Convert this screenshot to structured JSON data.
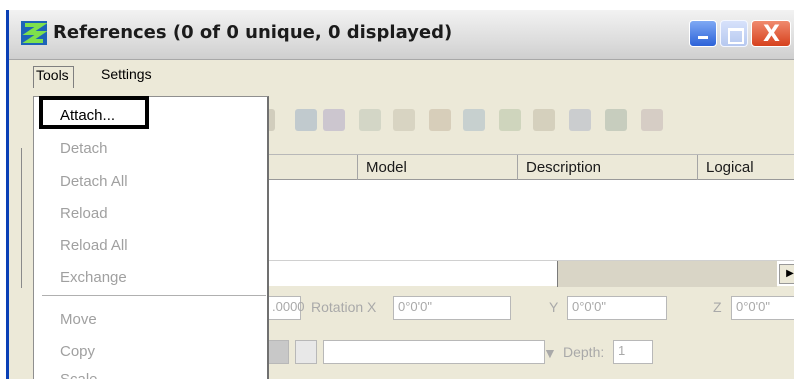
{
  "window": {
    "title": "References (0 of 0 unique, 0 displayed)",
    "controls": [
      "minimize-icon",
      "maximize-icon",
      "close-icon"
    ],
    "close_glyph": "X"
  },
  "menubar": {
    "tools": "Tools",
    "settings": "Settings"
  },
  "tools_menu": {
    "items": [
      {
        "label": "Attach...",
        "enabled": true
      },
      {
        "label": "Detach",
        "enabled": false
      },
      {
        "label": "Detach All",
        "enabled": false
      },
      {
        "label": "Reload",
        "enabled": false
      },
      {
        "label": "Reload All",
        "enabled": false
      },
      {
        "label": "Exchange",
        "enabled": false
      },
      {
        "label": "Move",
        "enabled": false
      },
      {
        "label": "Copy",
        "enabled": false
      },
      {
        "label": "Scale",
        "enabled": false
      }
    ]
  },
  "grid": {
    "columns": [
      "Model",
      "Description",
      "Logical"
    ]
  },
  "properties": {
    "scale_value": ".0000",
    "rotation_label": "Rotation X",
    "rotation_x": "0°0'0\"",
    "y_label": "Y",
    "y_value": "0°0'0\"",
    "z_label": "Z",
    "z_value": "0°0'0\"",
    "depth_label": "Depth:",
    "depth_value": "1"
  },
  "colors": {
    "accent": "#0a3fb5",
    "close": "#d6411d",
    "minimize": "#2c62d8",
    "disabled_text": "#a0a0a0"
  }
}
